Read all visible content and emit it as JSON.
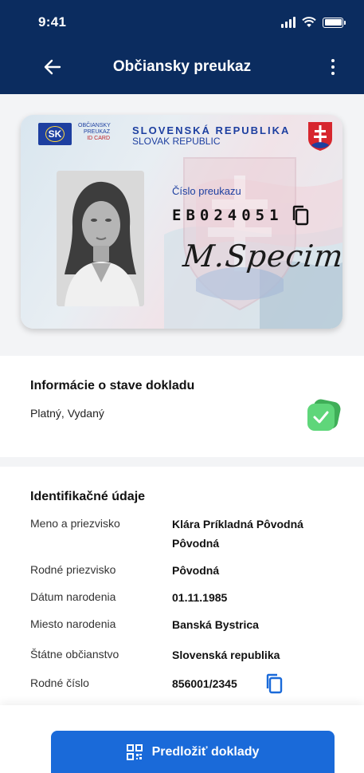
{
  "status_bar": {
    "time": "9:41"
  },
  "header": {
    "title": "Občiansky preukaz",
    "back_icon": "arrow-left-icon",
    "more_icon": "more-vertical-icon"
  },
  "id_card": {
    "country_code": "SK",
    "doc_type_lines": [
      "OBČIANSKY",
      "PREUKAZ",
      "ID CARD"
    ],
    "country_name": "SLOVENSKÁ REPUBLIKA",
    "country_name_en": "SLOVAK REPUBLIC",
    "doc_number_label": "Číslo preukazu",
    "doc_number": "EB024051",
    "signature": "M.Specimen"
  },
  "document_status": {
    "title": "Informácie o stave dokladu",
    "value": "Platný, Vydaný",
    "badge_color": "#4cc96b"
  },
  "identification": {
    "title": "Identifikačné údaje",
    "rows": [
      {
        "label": "Meno a priezvisko",
        "value": "Klára Príkladná Pôvodná Pôvodná"
      },
      {
        "label": "Rodné priezvisko",
        "value": "Pôvodná"
      },
      {
        "label": "Dátum narodenia",
        "value": "01.11.1985"
      },
      {
        "label": "Miesto narodenia",
        "value": "Banská Bystrica"
      },
      {
        "label": "Štátne občianstvo",
        "value": "Slovenská republika"
      },
      {
        "label": "Rodné číslo",
        "value": "856001/2345"
      }
    ]
  },
  "footer": {
    "present_button": "Predložiť doklady",
    "button_color": "#1a6ad9"
  }
}
